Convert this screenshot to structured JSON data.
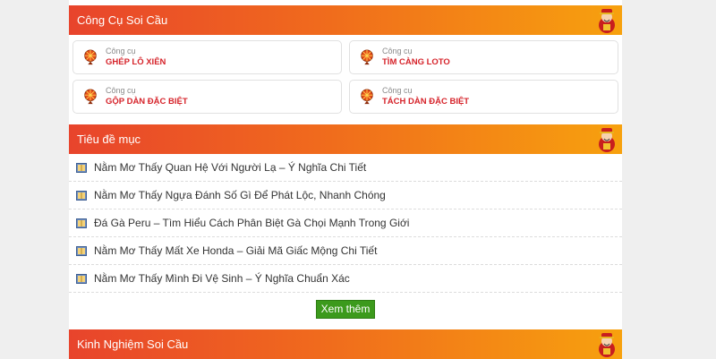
{
  "sections": {
    "tools_title": "Công Cụ Soi Cầu",
    "articles_title": "Tiêu đề mục",
    "experience_title": "Kinh Nghiệm Soi Cầu"
  },
  "tools": [
    {
      "caption": "Công cụ",
      "name": "GHÉP LÔ XIÊN"
    },
    {
      "caption": "Công cụ",
      "name": "TÌM CÀNG LOTO"
    },
    {
      "caption": "Công cụ",
      "name": "GỘP DÀN ĐẶC BIỆT"
    },
    {
      "caption": "Công cụ",
      "name": "TÁCH DÀN ĐẶC BIỆT"
    }
  ],
  "articles": [
    "Nằm Mơ Thấy Quan Hệ Với Người Lạ – Ý Nghĩa Chi Tiết",
    "Nằm Mơ Thấy Ngựa Đánh Số Gì Để Phát Lộc, Nhanh Chóng",
    "Đá Gà Peru – Tìm Hiểu Cách Phân Biệt Gà Chọi Mạnh Trong Giới",
    "Nằm Mơ Thấy Mất Xe Honda – Giải Mã Giấc Mộng Chi Tiết",
    "Nằm Mơ Thấy Mình Đi Vệ Sinh – Ý Nghĩa Chuẩn Xác"
  ],
  "more_button": "Xem thêm",
  "colors": {
    "header_start": "#e8442c",
    "header_end": "#f7a10e",
    "tool_name": "#d6232a",
    "more_button": "#3c9a1c"
  },
  "icons": {
    "header": "god-of-wealth-mascot-icon",
    "tool": "prize-wheel-icon",
    "article": "book-icon"
  }
}
